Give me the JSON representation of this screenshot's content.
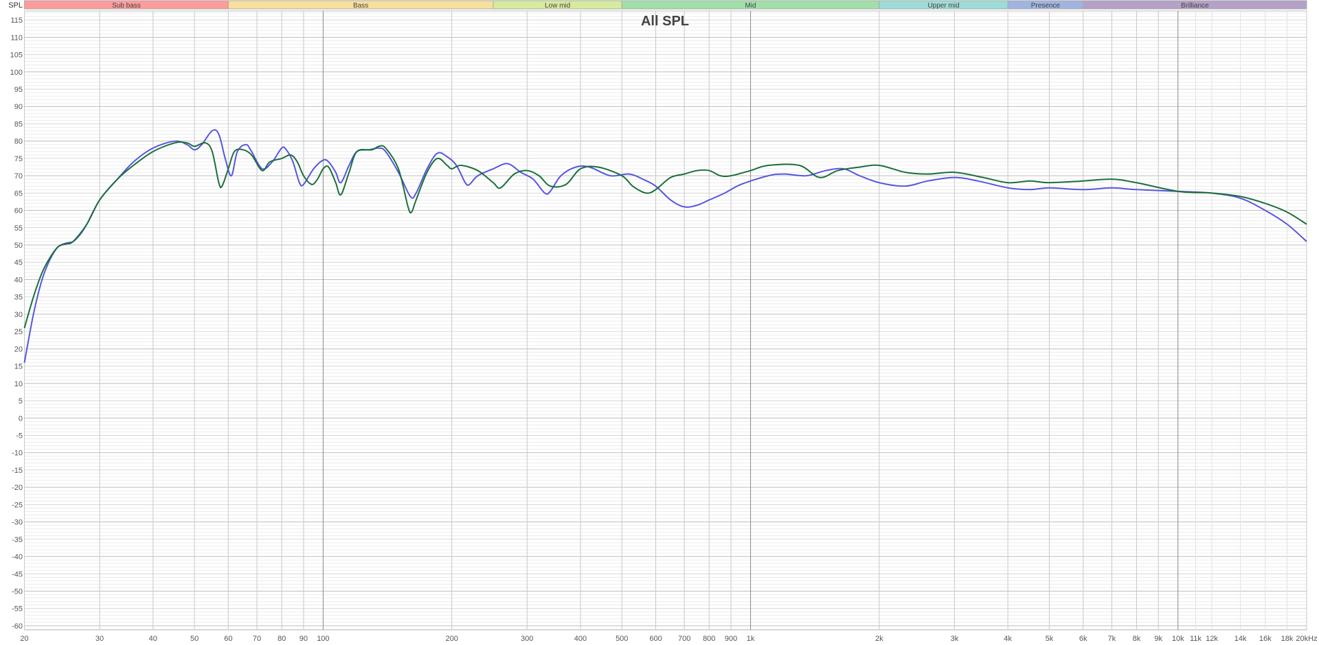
{
  "chart_data": {
    "type": "line",
    "title": "All SPL",
    "ylabel": "SPL",
    "xlabel": "Hz",
    "xscale": "log",
    "xlim": [
      20,
      20000
    ],
    "ylim": [
      -61.2,
      117.6
    ],
    "grid": true,
    "y_ticks": [
      115,
      110,
      105,
      100,
      95,
      90,
      85,
      80,
      75,
      70,
      65,
      60,
      55,
      50,
      45,
      40,
      35,
      30,
      25,
      20,
      15,
      10,
      5,
      0,
      -5,
      -10,
      -15,
      -20,
      -25,
      -30,
      -35,
      -40,
      -45,
      -50,
      -55,
      -60
    ],
    "x_ticks": [
      {
        "f": 20,
        "label": "20"
      },
      {
        "f": 30,
        "label": "30"
      },
      {
        "f": 40,
        "label": "40"
      },
      {
        "f": 50,
        "label": "50"
      },
      {
        "f": 60,
        "label": "60"
      },
      {
        "f": 70,
        "label": "70"
      },
      {
        "f": 80,
        "label": "80"
      },
      {
        "f": 90,
        "label": "90"
      },
      {
        "f": 100,
        "label": "100"
      },
      {
        "f": 200,
        "label": "200"
      },
      {
        "f": 300,
        "label": "300"
      },
      {
        "f": 400,
        "label": "400"
      },
      {
        "f": 500,
        "label": "500"
      },
      {
        "f": 600,
        "label": "600"
      },
      {
        "f": 700,
        "label": "700"
      },
      {
        "f": 800,
        "label": "800"
      },
      {
        "f": 900,
        "label": "900"
      },
      {
        "f": 1000,
        "label": "1k"
      },
      {
        "f": 2000,
        "label": "2k"
      },
      {
        "f": 3000,
        "label": "3k"
      },
      {
        "f": 4000,
        "label": "4k"
      },
      {
        "f": 5000,
        "label": "5k"
      },
      {
        "f": 6000,
        "label": "6k"
      },
      {
        "f": 7000,
        "label": "7k"
      },
      {
        "f": 8000,
        "label": "8k"
      },
      {
        "f": 9000,
        "label": "9k"
      },
      {
        "f": 10000,
        "label": "10k"
      },
      {
        "f": 11000,
        "label": "11k",
        "minor": true
      },
      {
        "f": 12000,
        "label": "12k",
        "minor": true
      },
      {
        "f": 14000,
        "label": "14k",
        "minor": true
      },
      {
        "f": 16000,
        "label": "16k",
        "minor": true
      },
      {
        "f": 18000,
        "label": "18k",
        "minor": true
      },
      {
        "f": 20000,
        "label": "20kHz"
      }
    ],
    "bands": [
      {
        "label": "Sub bass",
        "from": 20,
        "to": 60,
        "color": "#ff9b9b"
      },
      {
        "label": "Bass",
        "from": 60,
        "to": 250,
        "color": "#f8e09c"
      },
      {
        "label": "Low mid",
        "from": 250,
        "to": 500,
        "color": "#d7eb9c"
      },
      {
        "label": "Mid",
        "from": 500,
        "to": 2000,
        "color": "#a0e0a8"
      },
      {
        "label": "Upper mid",
        "from": 2000,
        "to": 4000,
        "color": "#9cdcd6"
      },
      {
        "label": "Presence",
        "from": 4000,
        "to": 6000,
        "color": "#a0b4e0"
      },
      {
        "label": "Brilliance",
        "from": 6000,
        "to": 20000,
        "color": "#b4a0c8"
      }
    ],
    "series": [
      {
        "name": "blue",
        "color": "#5555e0",
        "points": [
          [
            20,
            16
          ],
          [
            21,
            30
          ],
          [
            22,
            40
          ],
          [
            23,
            46
          ],
          [
            24,
            49.5
          ],
          [
            25,
            50.5
          ],
          [
            26,
            51
          ],
          [
            27,
            53
          ],
          [
            28,
            56
          ],
          [
            30,
            63
          ],
          [
            33,
            69
          ],
          [
            36,
            74
          ],
          [
            40,
            78
          ],
          [
            45,
            80
          ],
          [
            48,
            79
          ],
          [
            50,
            77.5
          ],
          [
            52,
            79
          ],
          [
            55,
            83
          ],
          [
            57,
            82
          ],
          [
            59,
            75
          ],
          [
            61,
            70
          ],
          [
            63,
            77
          ],
          [
            66,
            79
          ],
          [
            68,
            77
          ],
          [
            72,
            72
          ],
          [
            76,
            74
          ],
          [
            80,
            78
          ],
          [
            82,
            77.5
          ],
          [
            85,
            74
          ],
          [
            88,
            68
          ],
          [
            90,
            67.5
          ],
          [
            95,
            72
          ],
          [
            100,
            74.5
          ],
          [
            103,
            74
          ],
          [
            107,
            71
          ],
          [
            110,
            68
          ],
          [
            115,
            73
          ],
          [
            120,
            77
          ],
          [
            128,
            77.5
          ],
          [
            135,
            78
          ],
          [
            140,
            77
          ],
          [
            150,
            71
          ],
          [
            160,
            64
          ],
          [
            165,
            65
          ],
          [
            175,
            72
          ],
          [
            185,
            76.5
          ],
          [
            195,
            75.5
          ],
          [
            205,
            73
          ],
          [
            215,
            68
          ],
          [
            220,
            67.5
          ],
          [
            230,
            70
          ],
          [
            250,
            72
          ],
          [
            270,
            73.5
          ],
          [
            290,
            71
          ],
          [
            310,
            69
          ],
          [
            330,
            65
          ],
          [
            340,
            65.5
          ],
          [
            360,
            70
          ],
          [
            390,
            72.5
          ],
          [
            420,
            72.5
          ],
          [
            470,
            70
          ],
          [
            520,
            70.5
          ],
          [
            560,
            69
          ],
          [
            600,
            67
          ],
          [
            650,
            63
          ],
          [
            700,
            61
          ],
          [
            750,
            61.5
          ],
          [
            800,
            63
          ],
          [
            870,
            65
          ],
          [
            950,
            67.5
          ],
          [
            1100,
            70
          ],
          [
            1200,
            70.5
          ],
          [
            1350,
            70
          ],
          [
            1500,
            71.5
          ],
          [
            1650,
            72
          ],
          [
            1800,
            70
          ],
          [
            2000,
            68
          ],
          [
            2300,
            67
          ],
          [
            2600,
            68.5
          ],
          [
            3000,
            69.5
          ],
          [
            3400,
            68.5
          ],
          [
            4000,
            66.5
          ],
          [
            4500,
            66
          ],
          [
            5000,
            66.5
          ],
          [
            6000,
            66
          ],
          [
            7000,
            66.5
          ],
          [
            8000,
            66
          ],
          [
            10000,
            65.5
          ],
          [
            12000,
            65
          ],
          [
            14000,
            63.5
          ],
          [
            16000,
            60
          ],
          [
            18000,
            56
          ],
          [
            20000,
            51
          ]
        ]
      },
      {
        "name": "green",
        "color": "#1a6e3a",
        "points": [
          [
            20,
            26
          ],
          [
            21,
            35
          ],
          [
            22,
            42
          ],
          [
            23,
            46.5
          ],
          [
            24,
            49.5
          ],
          [
            25,
            50.3
          ],
          [
            26,
            51
          ],
          [
            28,
            56
          ],
          [
            30,
            63
          ],
          [
            33,
            69
          ],
          [
            36,
            73
          ],
          [
            40,
            77
          ],
          [
            45,
            79.5
          ],
          [
            48,
            79.5
          ],
          [
            50,
            78.5
          ],
          [
            53,
            79.5
          ],
          [
            55,
            77
          ],
          [
            57,
            68
          ],
          [
            58,
            67
          ],
          [
            60,
            72
          ],
          [
            62,
            77
          ],
          [
            65,
            77.5
          ],
          [
            68,
            76
          ],
          [
            72,
            71.5
          ],
          [
            75,
            74
          ],
          [
            80,
            75
          ],
          [
            84,
            76
          ],
          [
            87,
            74
          ],
          [
            90,
            70
          ],
          [
            94,
            67.5
          ],
          [
            97,
            69
          ],
          [
            100,
            72
          ],
          [
            103,
            72.5
          ],
          [
            107,
            68
          ],
          [
            110,
            64.5
          ],
          [
            115,
            71
          ],
          [
            120,
            77
          ],
          [
            130,
            77.5
          ],
          [
            135,
            78.5
          ],
          [
            140,
            78
          ],
          [
            150,
            72
          ],
          [
            158,
            61
          ],
          [
            161,
            59.5
          ],
          [
            165,
            63
          ],
          [
            175,
            71
          ],
          [
            185,
            75
          ],
          [
            195,
            73
          ],
          [
            200,
            72
          ],
          [
            210,
            73
          ],
          [
            230,
            71.5
          ],
          [
            250,
            68
          ],
          [
            260,
            66.5
          ],
          [
            280,
            70.5
          ],
          [
            300,
            71.5
          ],
          [
            320,
            70
          ],
          [
            340,
            67
          ],
          [
            370,
            67.5
          ],
          [
            400,
            72
          ],
          [
            440,
            72.5
          ],
          [
            500,
            70
          ],
          [
            530,
            67
          ],
          [
            570,
            65
          ],
          [
            600,
            66
          ],
          [
            650,
            69.5
          ],
          [
            700,
            70.5
          ],
          [
            750,
            71.5
          ],
          [
            800,
            71.5
          ],
          [
            850,
            70
          ],
          [
            900,
            70
          ],
          [
            1000,
            71.5
          ],
          [
            1100,
            73
          ],
          [
            1300,
            73
          ],
          [
            1450,
            69.5
          ],
          [
            1600,
            71.5
          ],
          [
            1800,
            72.5
          ],
          [
            2000,
            73
          ],
          [
            2300,
            71
          ],
          [
            2600,
            70.5
          ],
          [
            3000,
            71
          ],
          [
            3500,
            69.5
          ],
          [
            4000,
            68
          ],
          [
            4500,
            68.5
          ],
          [
            5000,
            68
          ],
          [
            6000,
            68.5
          ],
          [
            7000,
            69
          ],
          [
            8000,
            68
          ],
          [
            10000,
            65.5
          ],
          [
            12000,
            65
          ],
          [
            14000,
            64
          ],
          [
            16000,
            62
          ],
          [
            18000,
            59.5
          ],
          [
            20000,
            56
          ]
        ]
      }
    ]
  }
}
